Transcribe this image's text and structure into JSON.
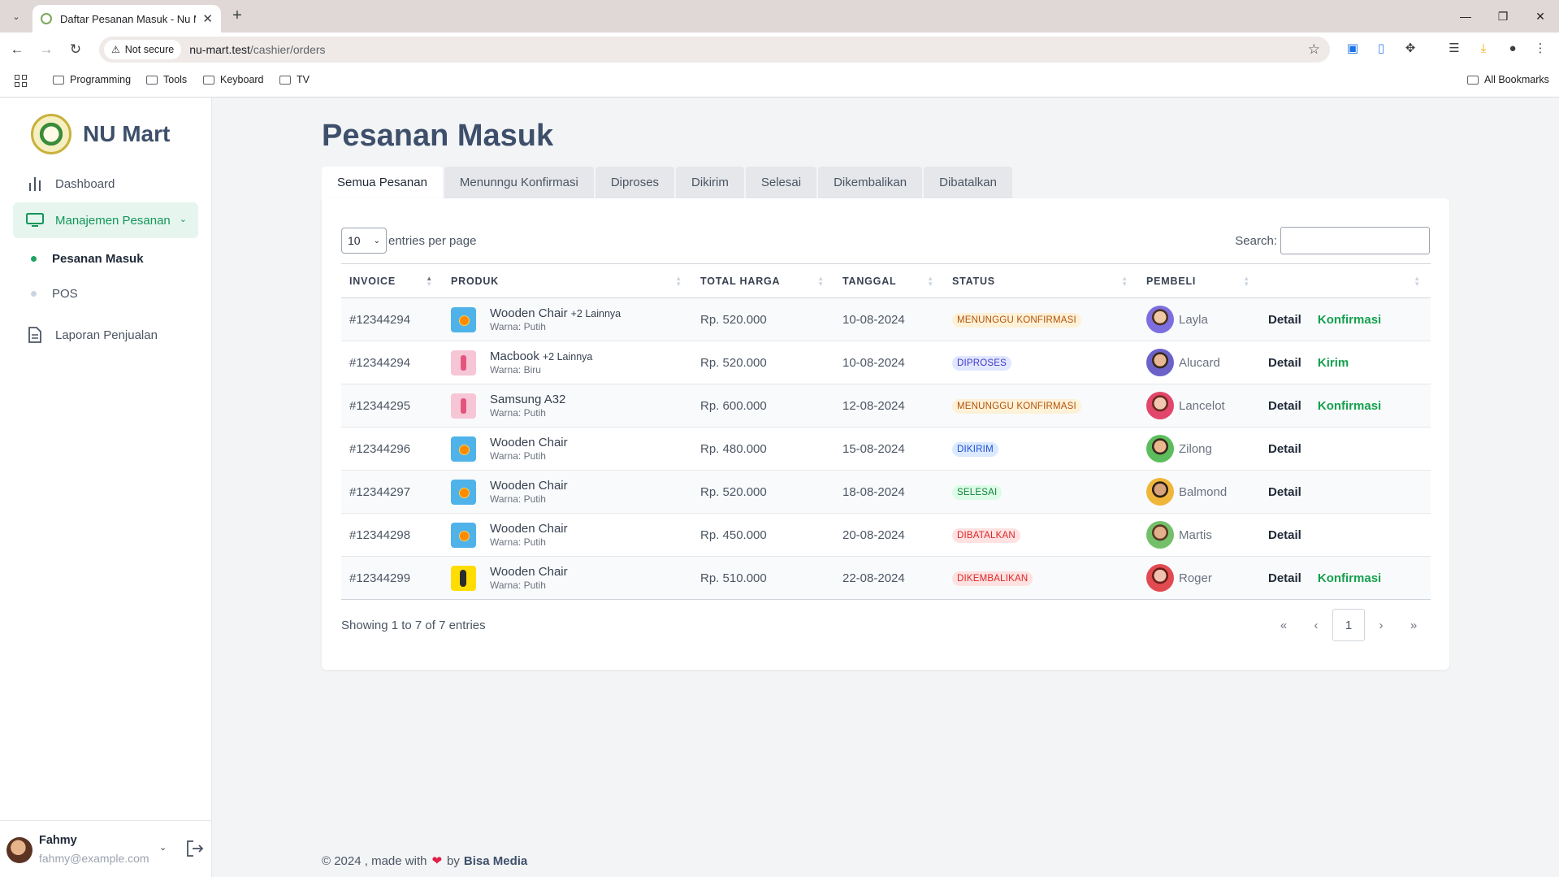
{
  "browser": {
    "tab_title": "Daftar Pesanan Masuk - Nu Ma",
    "security_label": "Not secure",
    "url_host": "nu-mart.test",
    "url_path": "/cashier/orders",
    "bookmarks": [
      "Programming",
      "Tools",
      "Keyboard",
      "TV"
    ],
    "all_bookmarks": "All Bookmarks"
  },
  "sidebar": {
    "brand": "NU Mart",
    "nav": {
      "dashboard": "Dashboard",
      "orders": "Manajemen Pesanan",
      "incoming": "Pesanan Masuk",
      "pos": "POS",
      "report": "Laporan Penjualan"
    },
    "user": {
      "name": "Fahmy",
      "email": "fahmy@example.com"
    }
  },
  "main": {
    "title": "Pesanan Masuk",
    "tabs": [
      "Semua Pesanan",
      "Menunngu Konfirmasi",
      "Diproses",
      "Dikirim",
      "Selesai",
      "Dikembalikan",
      "Dibatalkan"
    ],
    "per_page_value": "10",
    "per_page_label": "entries per page",
    "search_label": "Search:",
    "columns": [
      "INVOICE",
      "PRODUK",
      "TOTAL HARGA",
      "TANGGAL",
      "STATUS",
      "PEMBELI"
    ],
    "rows": [
      {
        "invoice": "#12344294",
        "product": "Wooden Chair",
        "more": "+2 Lainnya",
        "variant": "Warna: Putih",
        "total": "Rp. 520.000",
        "date": "10-08-2024",
        "status": "MENUNGGU KONFIRMASI",
        "buyer": "Layla",
        "detail": "Detail",
        "action": "Konfirmasi"
      },
      {
        "invoice": "#12344294",
        "product": "Macbook",
        "more": "+2 Lainnya",
        "variant": "Warna: Biru",
        "total": "Rp. 520.000",
        "date": "10-08-2024",
        "status": "DIPROSES",
        "buyer": "Alucard",
        "detail": "Detail",
        "action": "Kirim"
      },
      {
        "invoice": "#12344295",
        "product": "Samsung A32",
        "more": "",
        "variant": "Warna: Putih",
        "total": "Rp. 600.000",
        "date": "12-08-2024",
        "status": "MENUNGGU KONFIRMASI",
        "buyer": "Lancelot",
        "detail": "Detail",
        "action": "Konfirmasi"
      },
      {
        "invoice": "#12344296",
        "product": "Wooden Chair",
        "more": "",
        "variant": "Warna: Putih",
        "total": "Rp. 480.000",
        "date": "15-08-2024",
        "status": "DIKIRIM",
        "buyer": "Zilong",
        "detail": "Detail",
        "action": ""
      },
      {
        "invoice": "#12344297",
        "product": "Wooden Chair",
        "more": "",
        "variant": "Warna: Putih",
        "total": "Rp. 520.000",
        "date": "18-08-2024",
        "status": "SELESAI",
        "buyer": "Balmond",
        "detail": "Detail",
        "action": ""
      },
      {
        "invoice": "#12344298",
        "product": "Wooden Chair",
        "more": "",
        "variant": "Warna: Putih",
        "total": "Rp. 450.000",
        "date": "20-08-2024",
        "status": "DIBATALKAN",
        "buyer": "Martis",
        "detail": "Detail",
        "action": ""
      },
      {
        "invoice": "#12344299",
        "product": "Wooden Chair",
        "more": "",
        "variant": "Warna: Putih",
        "total": "Rp. 510.000",
        "date": "22-08-2024",
        "status": "DIKEMBALIKAN",
        "buyer": "Roger",
        "detail": "Detail",
        "action": "Konfirmasi"
      }
    ],
    "showing": "Showing 1 to 7 of 7 entries",
    "pager": {
      "first": "«",
      "prev": "‹",
      "current": "1",
      "next": "›",
      "last": "»"
    }
  },
  "footer": {
    "text": "© 2024 , made with",
    "by": "by",
    "company": "Bisa Media"
  },
  "colors": {
    "accent": "#14965a",
    "title": "#3d4f6a",
    "heart": "#e11d48"
  }
}
